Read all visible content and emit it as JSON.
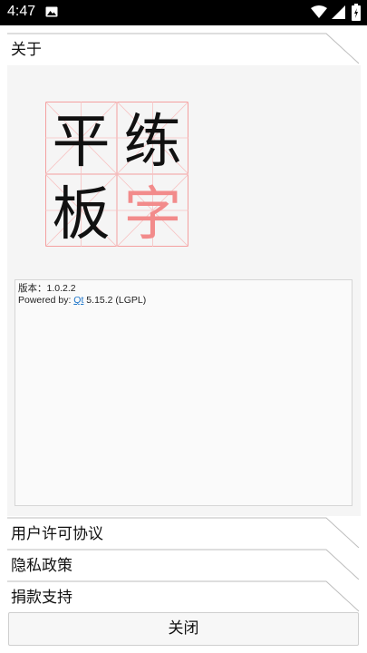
{
  "status_bar": {
    "time": "4:47",
    "icons": [
      "image-notification-icon",
      "wifi-icon",
      "signal-icon",
      "battery-icon"
    ]
  },
  "about": {
    "header_label": "关于",
    "logo": {
      "chars": [
        "平",
        "练",
        "板",
        "字"
      ],
      "grid_color": "#f08080",
      "highlight_color": "#f28b8b"
    },
    "info": {
      "version_line": "版本：1.0.2.2",
      "powered_prefix": "Powered by: ",
      "powered_link": "Qt",
      "powered_suffix": " 5.15.2 (LGPL)"
    }
  },
  "sections": [
    {
      "label": "用户许可协议"
    },
    {
      "label": "隐私政策"
    },
    {
      "label": "捐款支持"
    }
  ],
  "close_button": {
    "label": "关闭"
  }
}
